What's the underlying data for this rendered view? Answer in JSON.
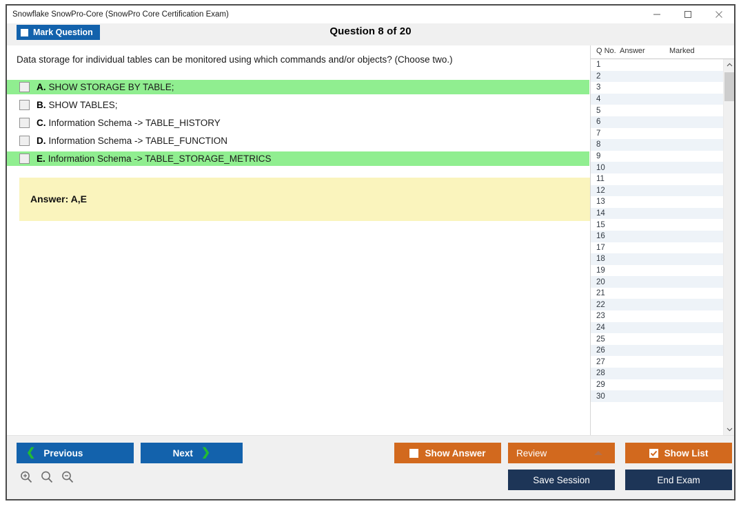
{
  "window": {
    "title": "Snowflake SnowPro-Core (SnowPro Core Certification Exam)",
    "minimize_label": "Minimize",
    "maximize_label": "Maximize",
    "close_label": "Close"
  },
  "toolbar": {
    "mark_question_label": "Mark Question",
    "question_title": "Question 8 of 20"
  },
  "question": {
    "text": "Data storage for individual tables can be monitored using which commands and/or objects? (Choose two.)",
    "options": [
      {
        "letter": "A.",
        "text": "SHOW STORAGE BY TABLE;",
        "highlighted": true,
        "checked": false
      },
      {
        "letter": "B.",
        "text": "SHOW TABLES;",
        "highlighted": false,
        "checked": false
      },
      {
        "letter": "C.",
        "text": "Information Schema -> TABLE_HISTORY",
        "highlighted": false,
        "checked": false
      },
      {
        "letter": "D.",
        "text": "Information Schema -> TABLE_FUNCTION",
        "highlighted": false,
        "checked": false
      },
      {
        "letter": "E.",
        "text": "Information Schema -> TABLE_STORAGE_METRICS",
        "highlighted": true,
        "checked": false
      }
    ],
    "answer_label": "Answer: A,E"
  },
  "sidebar": {
    "headers": {
      "qno": "Q No.",
      "answer": "Answer",
      "marked": "Marked"
    },
    "rows": [
      {
        "qno": "1",
        "answer": "",
        "marked": ""
      },
      {
        "qno": "2",
        "answer": "",
        "marked": ""
      },
      {
        "qno": "3",
        "answer": "",
        "marked": ""
      },
      {
        "qno": "4",
        "answer": "",
        "marked": ""
      },
      {
        "qno": "5",
        "answer": "",
        "marked": ""
      },
      {
        "qno": "6",
        "answer": "",
        "marked": ""
      },
      {
        "qno": "7",
        "answer": "",
        "marked": ""
      },
      {
        "qno": "8",
        "answer": "",
        "marked": ""
      },
      {
        "qno": "9",
        "answer": "",
        "marked": ""
      },
      {
        "qno": "10",
        "answer": "",
        "marked": ""
      },
      {
        "qno": "11",
        "answer": "",
        "marked": ""
      },
      {
        "qno": "12",
        "answer": "",
        "marked": ""
      },
      {
        "qno": "13",
        "answer": "",
        "marked": ""
      },
      {
        "qno": "14",
        "answer": "",
        "marked": ""
      },
      {
        "qno": "15",
        "answer": "",
        "marked": ""
      },
      {
        "qno": "16",
        "answer": "",
        "marked": ""
      },
      {
        "qno": "17",
        "answer": "",
        "marked": ""
      },
      {
        "qno": "18",
        "answer": "",
        "marked": ""
      },
      {
        "qno": "19",
        "answer": "",
        "marked": ""
      },
      {
        "qno": "20",
        "answer": "",
        "marked": ""
      },
      {
        "qno": "21",
        "answer": "",
        "marked": ""
      },
      {
        "qno": "22",
        "answer": "",
        "marked": ""
      },
      {
        "qno": "23",
        "answer": "",
        "marked": ""
      },
      {
        "qno": "24",
        "answer": "",
        "marked": ""
      },
      {
        "qno": "25",
        "answer": "",
        "marked": ""
      },
      {
        "qno": "26",
        "answer": "",
        "marked": ""
      },
      {
        "qno": "27",
        "answer": "",
        "marked": ""
      },
      {
        "qno": "28",
        "answer": "",
        "marked": ""
      },
      {
        "qno": "29",
        "answer": "",
        "marked": ""
      },
      {
        "qno": "30",
        "answer": "",
        "marked": ""
      }
    ]
  },
  "footer": {
    "previous_label": "Previous",
    "next_label": "Next",
    "show_answer_label": "Show Answer",
    "show_answer_checked": false,
    "review_label": "Review",
    "show_list_label": "Show List",
    "show_list_checked": true,
    "save_session_label": "Save Session",
    "end_exam_label": "End Exam",
    "zoom_in_label": "Zoom In",
    "zoom_reset_label": "Zoom",
    "zoom_out_label": "Zoom Out"
  },
  "colors": {
    "accent_blue": "#1362ac",
    "accent_orange": "#d2691e",
    "navy": "#1d3557",
    "highlight_green": "#90ee90",
    "answer_yellow": "#faf4bd",
    "chevron_green": "#22bb33"
  }
}
